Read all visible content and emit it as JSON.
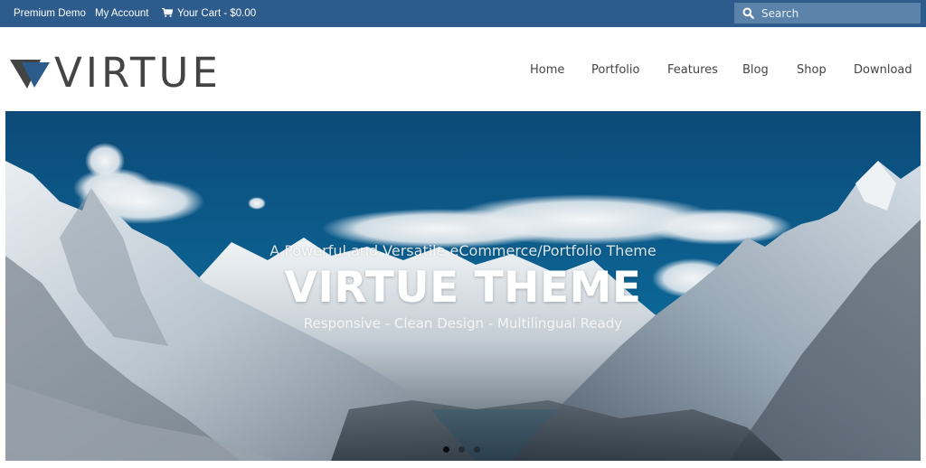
{
  "topbar": {
    "links": [
      {
        "label": "Premium Demo"
      },
      {
        "label": "My Account"
      },
      {
        "label": "Your Cart - $0.00",
        "icon": "cart-icon"
      }
    ],
    "search": {
      "placeholder": "Search",
      "icon": "search-icon"
    }
  },
  "brand": {
    "name": "VIRTUE",
    "logo_icon": "triangle-logo-icon",
    "colors": {
      "topbar": "#2d5c8c",
      "accent": "#2d5c8c",
      "logo_dark": "#444444"
    }
  },
  "nav": {
    "items": [
      {
        "label": "Home"
      },
      {
        "label": "Portfolio"
      },
      {
        "label": "Features"
      },
      {
        "label": "Blog"
      },
      {
        "label": "Shop"
      },
      {
        "label": "Download"
      }
    ]
  },
  "hero": {
    "subtitle": "A Powerful and Versatile eCommerce/Portfolio Theme",
    "title": "VIRTUE THEME",
    "caption": "Responsive - Clean Design - Multilingual Ready",
    "slides_total": 3,
    "active_slide": 1
  }
}
